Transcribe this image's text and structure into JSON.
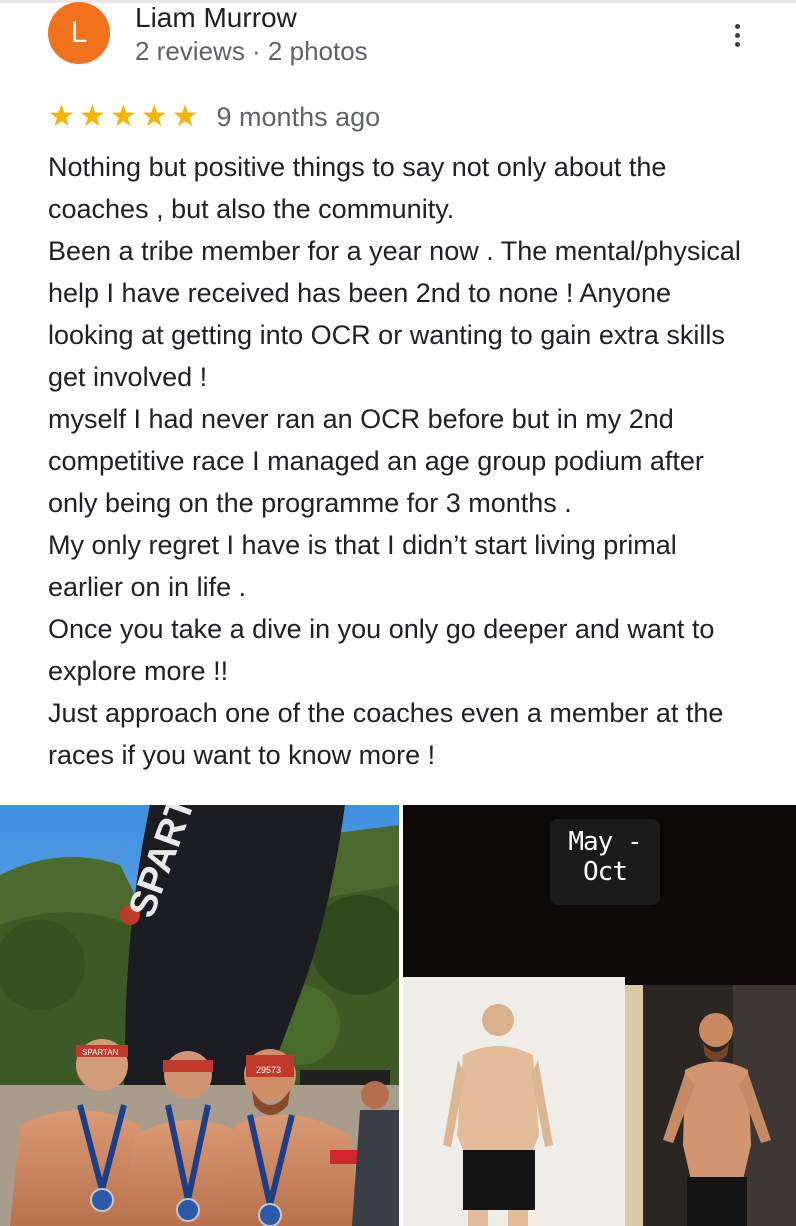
{
  "author": {
    "initial": "L",
    "name": "Liam Murrow",
    "meta": "2 reviews · 2 photos",
    "avatar_color": "#f2711c"
  },
  "review": {
    "stars": 5,
    "star_color": "#f6b400",
    "time": "9 months ago",
    "lines": [
      "Nothing but positive things to say not only about the coaches , but also the community.",
      "Been a tribe member for a year now . The mental/physical help I have received has been 2nd to none ! Anyone looking at getting into OCR or wanting to gain extra skills get involved !",
      "myself I had never ran an OCR before but in my 2nd competitive race I managed an age group podium after only being on the programme for 3 months .",
      "My only regret I have is that I didn’t start living primal earlier on in life .",
      "Once you take a dive in you only go deeper and want to explore more !!",
      "Just approach one of the coaches even a member at the races if you want to know more !"
    ]
  },
  "photos": {
    "photo1": {
      "banner_text": "SPARTAN",
      "headband_text": "SPARTAN",
      "bib_number": "29573"
    },
    "photo2": {
      "caption": "May -Oct"
    }
  },
  "icons": {
    "more": "more-vert-icon",
    "star": "star-icon"
  }
}
